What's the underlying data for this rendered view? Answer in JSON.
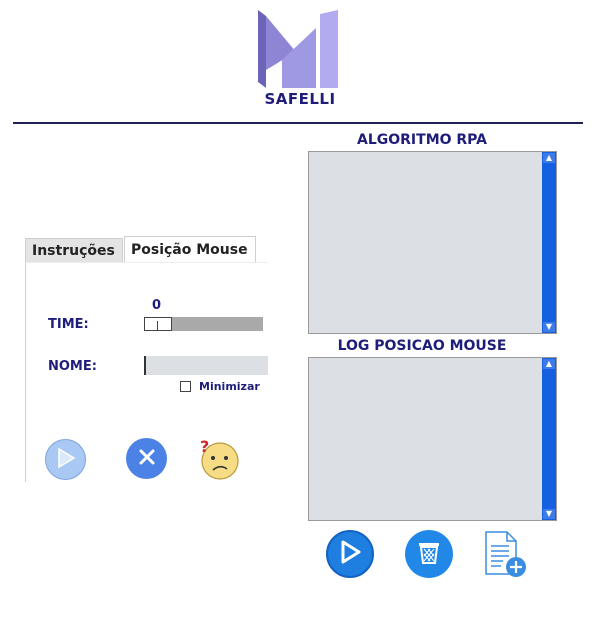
{
  "brand": {
    "name": "SAFELLI"
  },
  "tabs": [
    {
      "label": "Instruções"
    },
    {
      "label": "Posição Mouse"
    }
  ],
  "form": {
    "time_label": "TIME:",
    "time_value": "0",
    "time_fraction": 0.0,
    "nome_label": "NOME:",
    "nome_value": "",
    "minimize_label": "Minimizar",
    "minimize_checked": false
  },
  "panels": {
    "algorithm_title": "ALGORITMO RPA",
    "algorithm_text": "",
    "log_title": "LOG POSICAO MOUSE",
    "log_text": ""
  },
  "icons": {
    "left_play": "play-icon",
    "left_close": "close-icon",
    "left_help": "confused-face-icon",
    "run": "play-icon",
    "trash": "trash-icon",
    "new_file": "new-file-icon"
  },
  "colors": {
    "brand": "#1e1e7a",
    "accent_blue": "#1e7fe0",
    "scrollbar": "#1560e0",
    "textarea_bg": "#dcdfe3"
  }
}
